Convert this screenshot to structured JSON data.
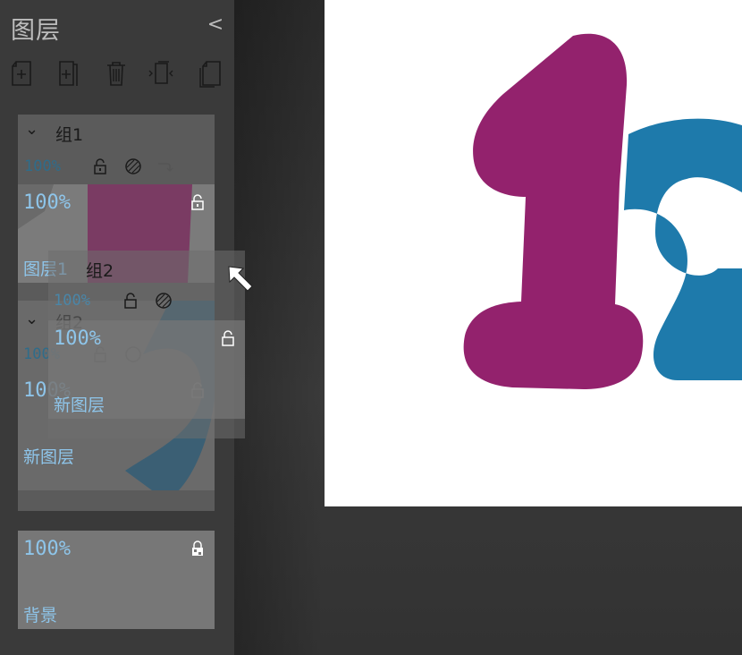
{
  "panel": {
    "title": "图层",
    "collapse_glyph": "<",
    "toolbar": [
      "add-layer-icon",
      "add-group-icon",
      "trash-icon",
      "merge-layers-icon",
      "duplicate-layer-icon"
    ]
  },
  "layers": {
    "group1": {
      "name": "组1",
      "opacity": "100%",
      "expand_glyph": "⌄"
    },
    "layer1": {
      "name": "图层1",
      "opacity": "100%"
    },
    "group2": {
      "name": "组2",
      "opacity": "100%",
      "expand_glyph": "⌄"
    },
    "new_layer": {
      "name": "新图层",
      "opacity": "100%"
    },
    "background": {
      "name": "背景",
      "opacity": "100%"
    }
  },
  "drag_ghost": {
    "group_name": "组2",
    "group_opacity": "100%",
    "layer_opacity": "100%",
    "layer_name": "新图层"
  },
  "colors": {
    "canvas_magenta": "#93226d",
    "canvas_blue": "#1e7aab",
    "opacity_text": "#8ec5ea",
    "panel_bg": "#3a3a3a"
  }
}
